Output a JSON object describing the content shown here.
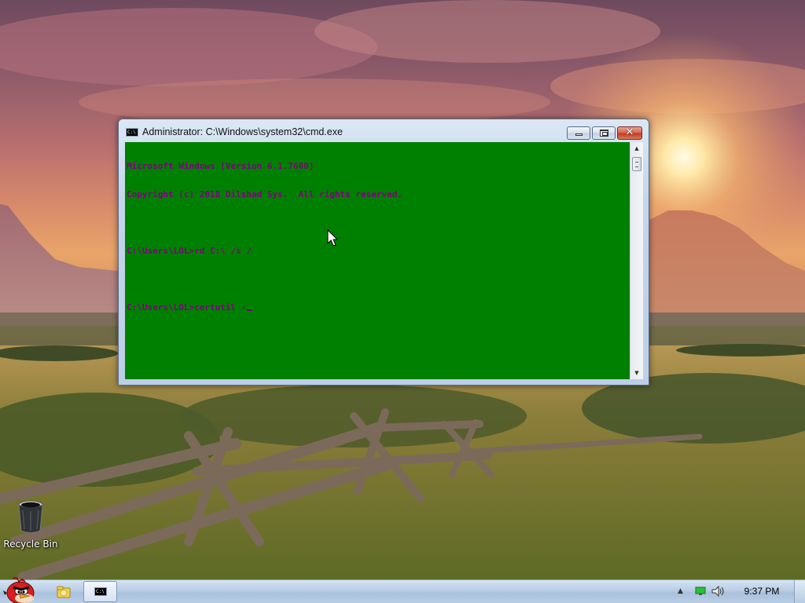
{
  "desktop": {
    "wallpaper": "sunset-meadow-with-fence",
    "icons": [
      {
        "label": "Recycle Bin",
        "icon": "recycle-bin-icon"
      }
    ]
  },
  "cmd_window": {
    "title": "Administrator: C:\\Windows\\system32\\cmd.exe",
    "console_text_color": "#800080",
    "console_background": "#008000",
    "lines": [
      "Microsoft Windows [Version 6.1.7600]",
      "Copyright (c) 2018 Dilshad Sys.  All rights reserved.",
      "",
      "C:\\Users\\LOL>rd C:\\ /s /",
      "",
      "C:\\Users\\LOL>certutil -"
    ],
    "buttons": {
      "minimize": "minimize-icon",
      "maximize": "maximize-icon",
      "close": "✕"
    }
  },
  "taskbar": {
    "start_icon": "angry-bird-start-icon",
    "pinned": [
      "explorer-icon"
    ],
    "running": [
      "cmd-icon"
    ],
    "tray": {
      "clock": "9:37 PM",
      "icons": [
        "show-hidden-icons-arrow",
        "network-icon",
        "volume-icon"
      ]
    }
  }
}
